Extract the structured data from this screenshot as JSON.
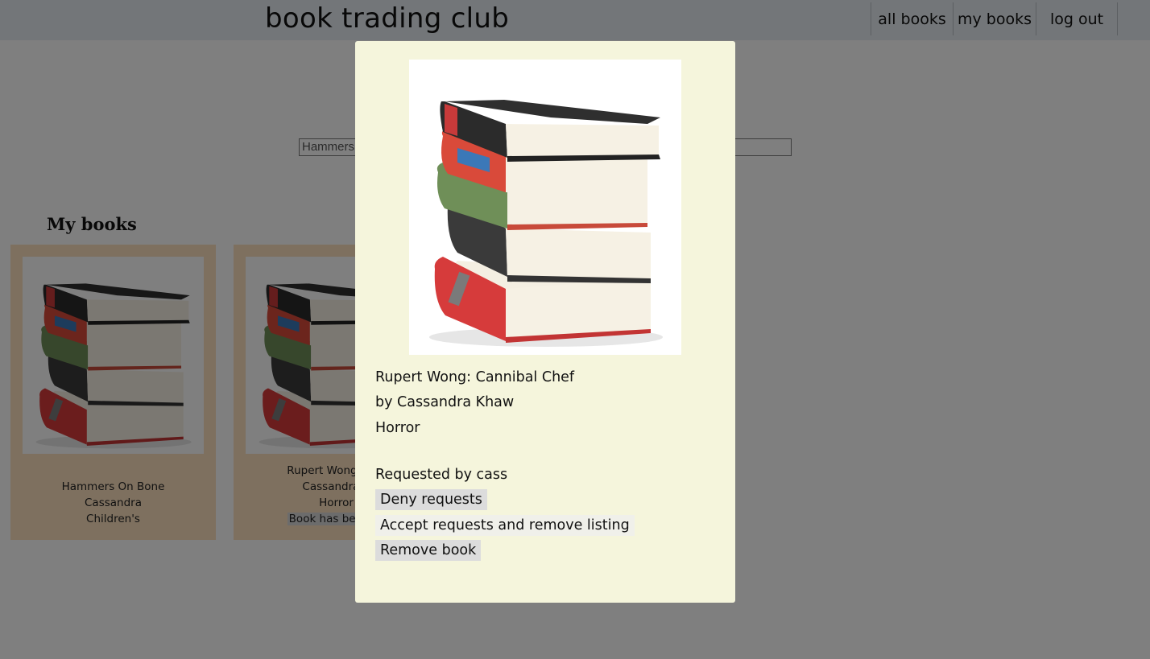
{
  "header": {
    "brand": "book trading club",
    "nav": [
      {
        "label": "all books"
      },
      {
        "label": "my books"
      },
      {
        "label": "log out"
      }
    ]
  },
  "search": {
    "value": "Hammers"
  },
  "section": {
    "title": "My books"
  },
  "cards": [
    {
      "title": "Hammers On Bone",
      "author": "Cassandra",
      "genre": "Children's",
      "status": ""
    },
    {
      "title": "Rupert Wong: Can",
      "author": "Cassandra K",
      "genre": "Horror",
      "status": "Book has been re"
    }
  ],
  "modal": {
    "title_line": "Rupert Wong: Cannibal Chef",
    "author_line": "by Cassandra Khaw",
    "genre": "Horror",
    "requested_line": "Requested by cass",
    "deny_label": "Deny requests",
    "accept_label": "Accept requests and remove listing",
    "remove_label": "Remove book"
  },
  "colors": {
    "card_bg": "#fce1bf",
    "modal_bg": "#f5f5dc",
    "overlay": "rgba(0,0,0,0.5)"
  },
  "icons": [
    "book-stack-image"
  ]
}
